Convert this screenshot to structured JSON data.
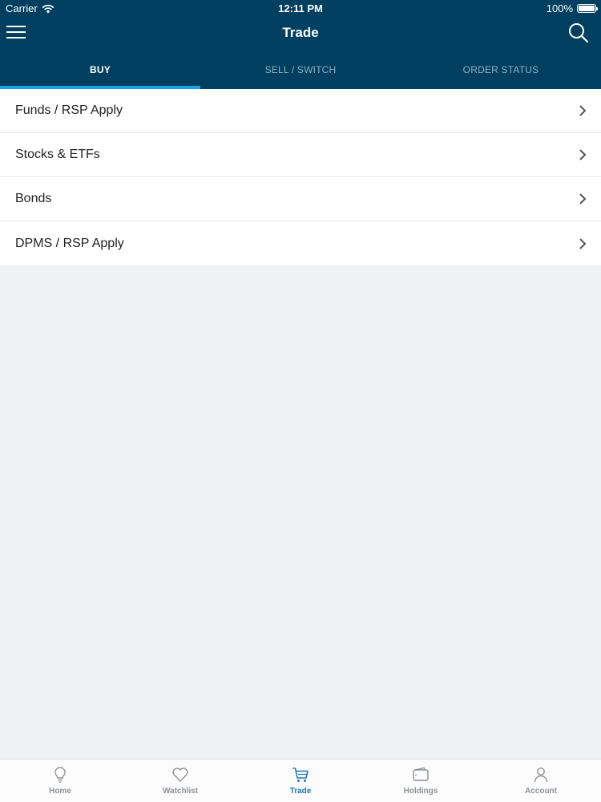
{
  "status_bar": {
    "carrier": "Carrier",
    "time": "12:11 PM",
    "battery": "100%"
  },
  "nav": {
    "title": "Trade",
    "menu_icon": "hamburger-icon",
    "search_icon": "search-icon"
  },
  "tabs": [
    {
      "label": "BUY",
      "active": true
    },
    {
      "label": "SELL / SWITCH",
      "active": false
    },
    {
      "label": "ORDER STATUS",
      "active": false
    }
  ],
  "buy_options": [
    {
      "label": "Funds / RSP Apply"
    },
    {
      "label": "Stocks & ETFs"
    },
    {
      "label": "Bonds"
    },
    {
      "label": "DPMS / RSP Apply"
    }
  ],
  "tab_bar": [
    {
      "label": "Home",
      "icon": "lightbulb-icon",
      "active": false
    },
    {
      "label": "Watchlist",
      "icon": "heart-icon",
      "active": false
    },
    {
      "label": "Trade",
      "icon": "cart-icon",
      "active": true
    },
    {
      "label": "Holdings",
      "icon": "wallet-icon",
      "active": false
    },
    {
      "label": "Account",
      "icon": "person-icon",
      "active": false
    }
  ],
  "colors": {
    "header": "#003f5f",
    "accent": "#1aa3e8",
    "active_tab_label": "#1f78b8",
    "background": "#eff1f4"
  }
}
